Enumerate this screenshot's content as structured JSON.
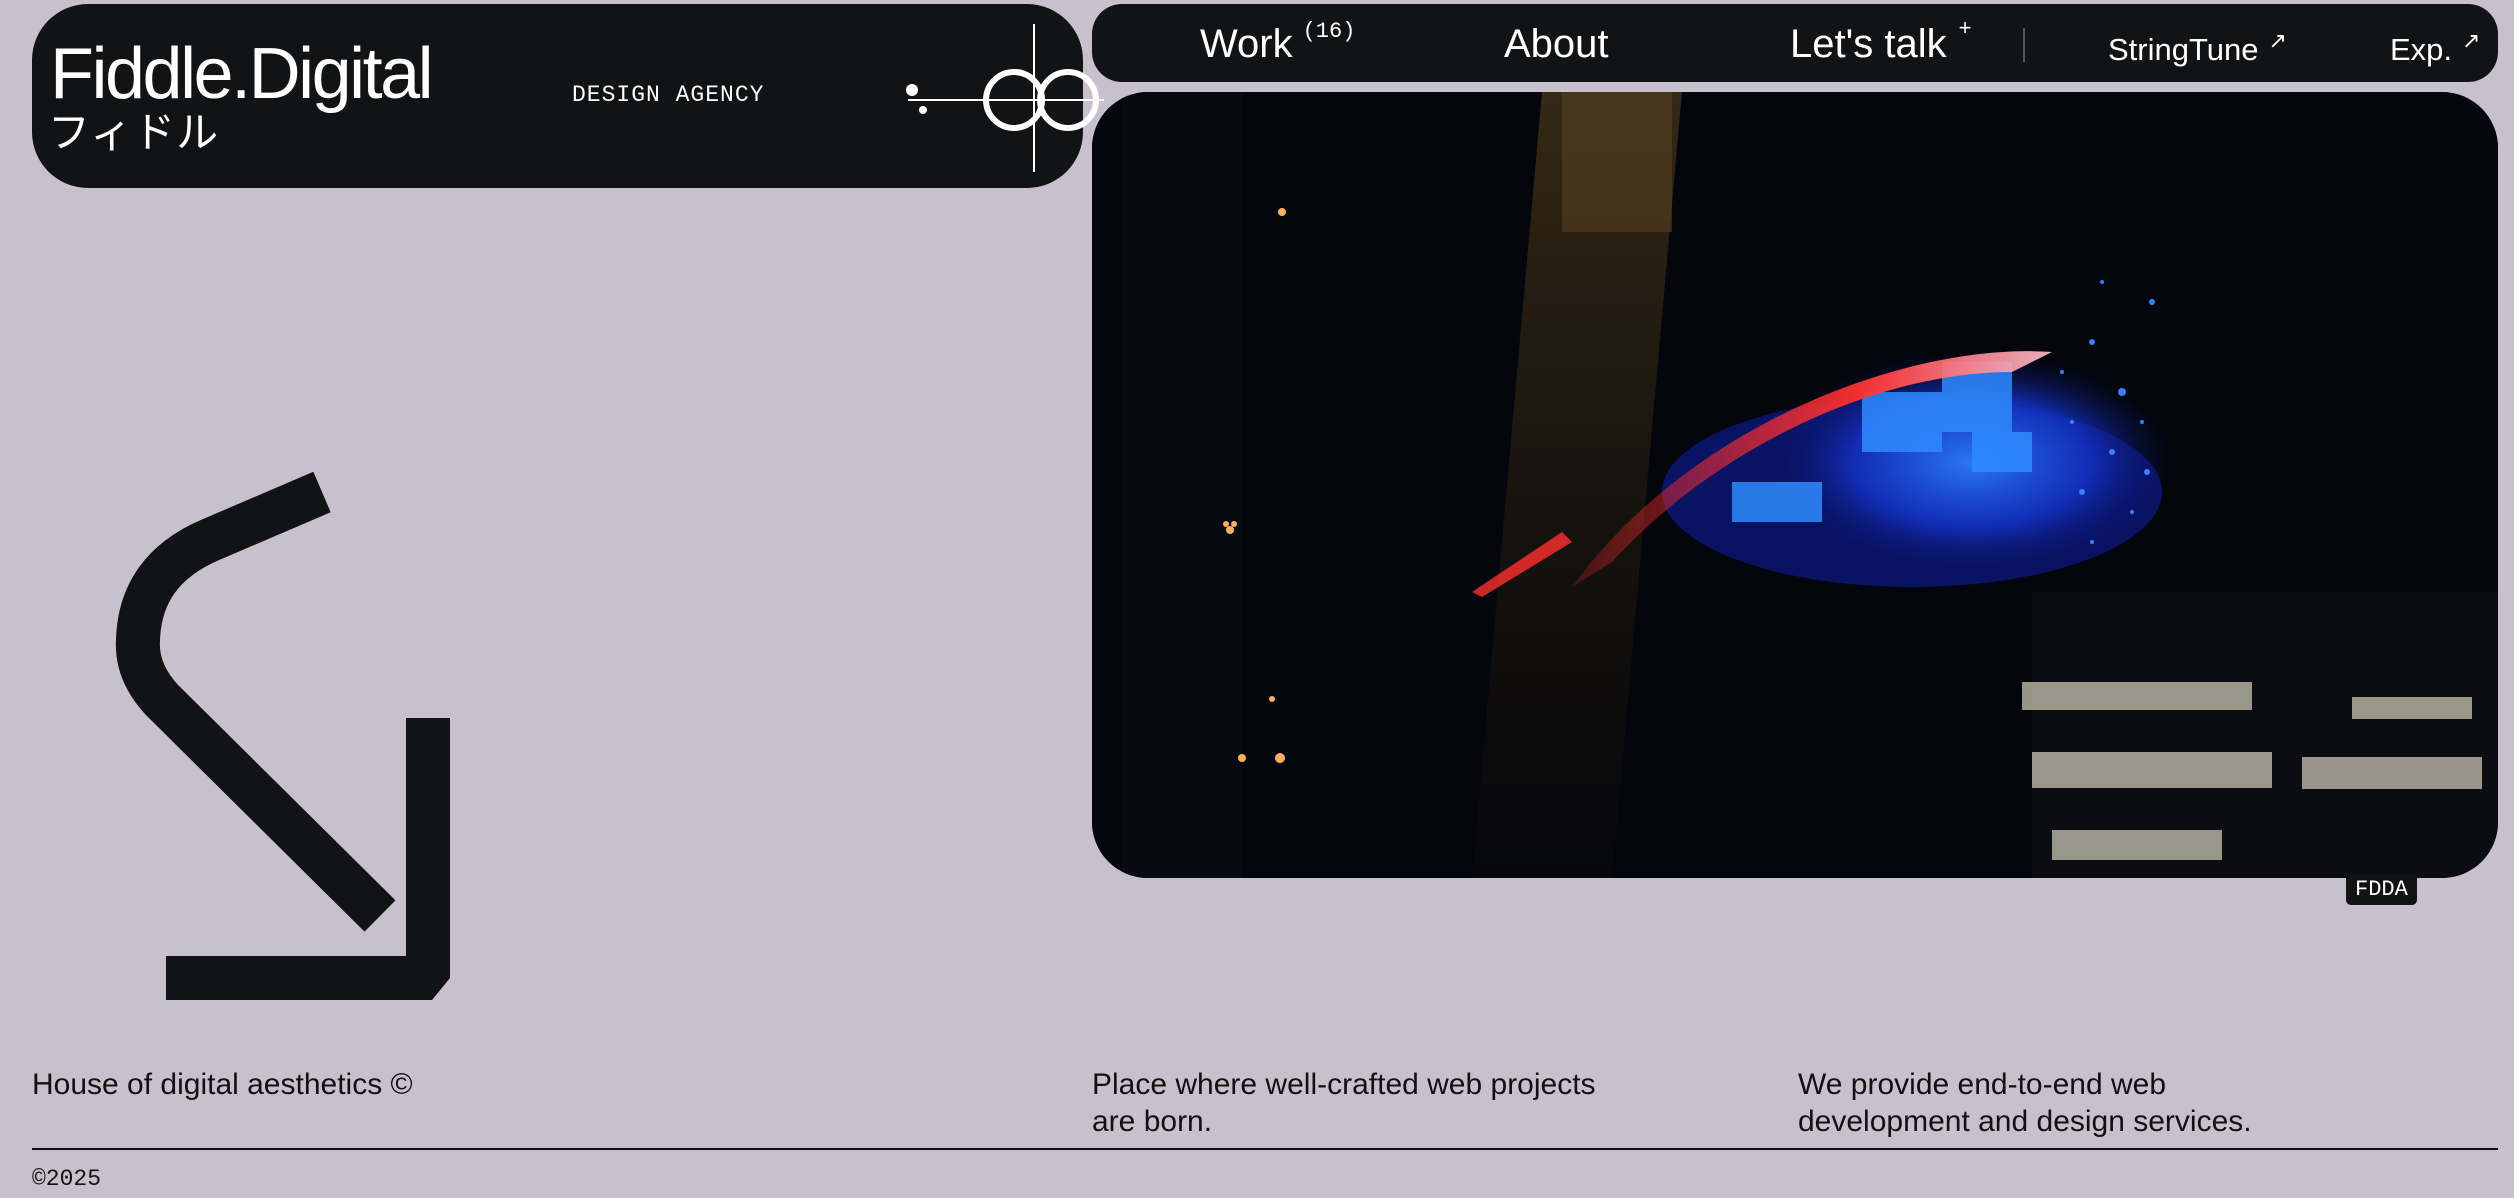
{
  "brand": {
    "name": "Fiddle.Digital",
    "name_jp": "フィドル",
    "subtitle": "DESIGN AGENCY"
  },
  "nav": {
    "work_label": "Work",
    "work_count": "(16)",
    "about_label": "About",
    "talk_label": "Let's talk",
    "talk_marker": "+",
    "stringtune_label": "StringTune",
    "exp_label": "Exp.",
    "external_arrow": "↗"
  },
  "media": {
    "tag": "FDDA"
  },
  "taglines": {
    "left": "House of digital aesthetics ©",
    "middle_line1": "Place where well-crafted web projects",
    "middle_line2": "are born.",
    "right_line1": "We provide end-to-end web",
    "right_line2": "development and design services."
  },
  "footer": {
    "copyright": "©2025"
  },
  "colors": {
    "background": "#c7c1cd",
    "card": "#121314",
    "text": "#111111"
  }
}
